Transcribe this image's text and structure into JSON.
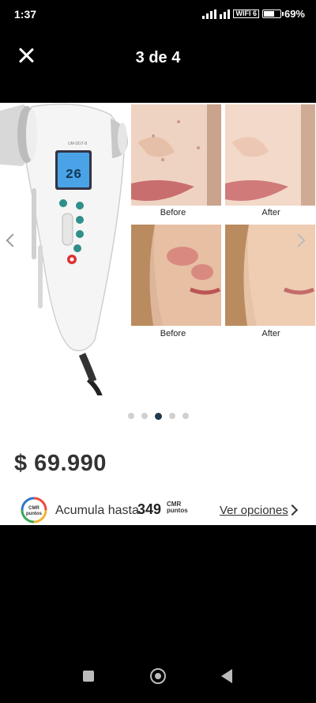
{
  "status": {
    "time": "1:37",
    "battery": "69%",
    "wifi_label": "WIFI 6",
    "battery_level": 0.69
  },
  "header": {
    "counter": "3 de 4"
  },
  "gallery": {
    "captions": [
      "Before",
      "After",
      "Before",
      "After"
    ],
    "device_screen_text": "26",
    "device_brand_text": "UM-DGT-8",
    "slide_count": 5,
    "active_slide": 2
  },
  "product": {
    "price": "$ 69.990"
  },
  "points": {
    "prefix": "Acumula hasta",
    "amount": "349",
    "logo_top": "CMR",
    "logo_bottom": "puntos",
    "options_label": "Ver opciones"
  }
}
